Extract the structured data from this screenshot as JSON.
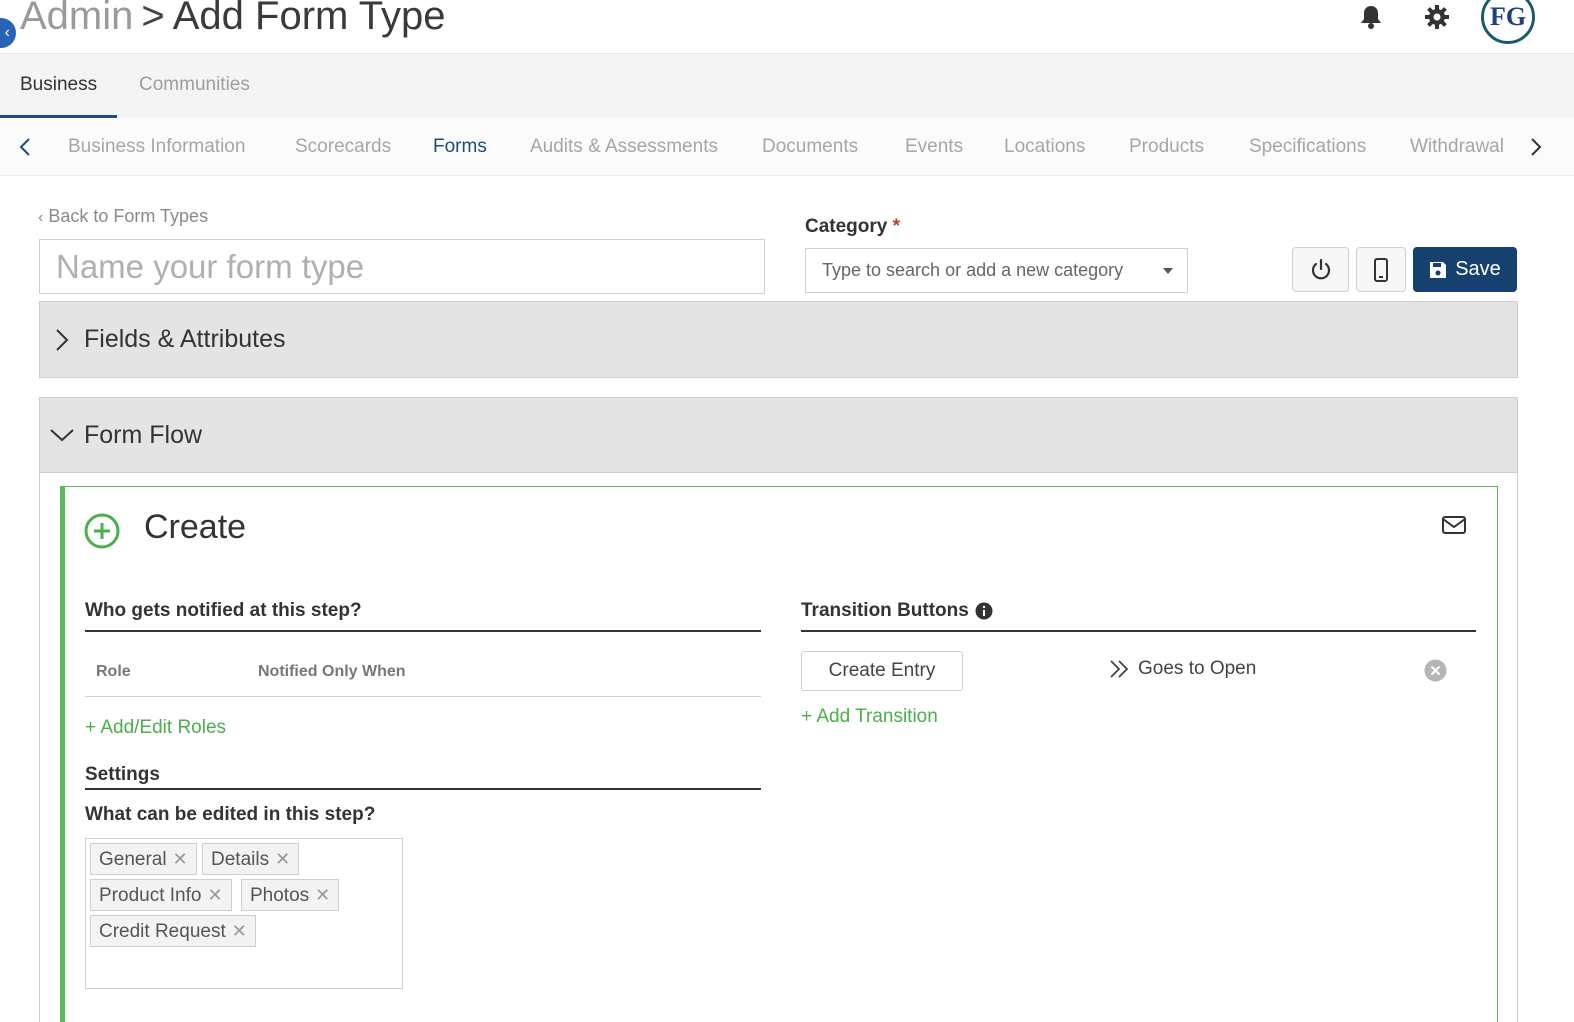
{
  "header": {
    "breadcrumb_root": "Admin",
    "breadcrumb_sep": ">",
    "breadcrumb_current": "Add Form Type",
    "avatar_text": "FG",
    "icons": [
      "bell-icon",
      "gear-icon"
    ]
  },
  "top_tabs": [
    {
      "label": "Business",
      "active": true
    },
    {
      "label": "Communities",
      "active": false
    }
  ],
  "subnav": {
    "items": [
      "Business Information",
      "Scorecards",
      "Forms",
      "Audits & Assessments",
      "Documents",
      "Events",
      "Locations",
      "Products",
      "Specifications",
      "Withdrawal"
    ],
    "active": "Forms"
  },
  "form": {
    "back_link": "Back to Form Types",
    "name_placeholder": "Name your form type",
    "category_label": "Category",
    "category_required": "*",
    "category_placeholder": "Type to search or add a new category",
    "save_label": "Save"
  },
  "panels": {
    "fields_title": "Fields & Attributes",
    "flow_title": "Form Flow"
  },
  "step": {
    "title": "Create",
    "notified_title": "Who gets notified at this step?",
    "col_role": "Role",
    "col_notified": "Notified Only When",
    "add_roles": "Add/Edit Roles",
    "settings_title": "Settings",
    "editable_title": "What can be edited in this step?",
    "tags": [
      "General",
      "Details",
      "Product Info",
      "Photos",
      "Credit Request"
    ],
    "transitions_title": "Transition Buttons",
    "transition_button": "Create Entry",
    "transition_target": "Goes to Open",
    "add_transition": "Add Transition"
  },
  "colors": {
    "primary": "#16406e",
    "success": "#5cb85c",
    "link_green": "#4cae4c",
    "required": "#c0392b"
  }
}
